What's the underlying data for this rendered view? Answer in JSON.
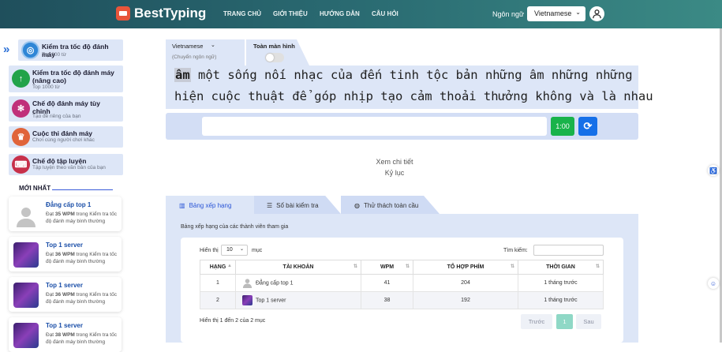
{
  "header": {
    "brand": "BestTyping",
    "nav": [
      "TRANG CHỦ",
      "GIỚI THIỆU",
      "HƯỚNG DẪN",
      "CÂU HỎI"
    ],
    "language_label": "Ngôn ngữ",
    "language_value": "Vietnamese"
  },
  "sidebar": {
    "items": [
      {
        "title": "Kiểm tra tốc độ đánh máy",
        "sub": "Top 200 từ",
        "color": "#2f86d6",
        "icon": "target-icon"
      },
      {
        "title": "Kiểm tra tốc độ đánh máy (nâng cao)",
        "sub": "Top 1000 từ",
        "color": "#22a34a",
        "icon": "arrow-up-icon"
      },
      {
        "title": "Chế độ đánh máy tùy chỉnh",
        "sub": "Tạo đề riêng của bạn",
        "color": "#c0307a",
        "icon": "cog-icon"
      },
      {
        "title": "Cuộc thi đánh máy",
        "sub": "Chơi cùng người chơi khác",
        "color": "#e0643a",
        "icon": "trophy-icon"
      },
      {
        "title": "Chế độ tập luyện",
        "sub": "Tập luyện theo văn bản của bạn",
        "color": "#c7304a",
        "icon": "keyboard-icon"
      }
    ],
    "newest_label": "MỚI NHẤT",
    "cards": [
      {
        "title": "Đẳng cấp top 1",
        "desc_pre": "Đạt ",
        "wpm": "35 WPM",
        "desc_post": " trong Kiểm tra tốc độ đánh máy bình thường"
      },
      {
        "title": "Top 1 server",
        "desc_pre": "Đạt ",
        "wpm": "36 WPM",
        "desc_post": " trong Kiểm tra tốc độ đánh máy bình thường"
      },
      {
        "title": "Top 1 server",
        "desc_pre": "Đạt ",
        "wpm": "36 WPM",
        "desc_post": " trong Kiểm tra tốc độ đánh máy bình thường"
      },
      {
        "title": "Top 1 server",
        "desc_pre": "Đạt ",
        "wpm": "38 WPM",
        "desc_post": " trong Kiểm tra tốc độ đánh máy bình thường"
      }
    ]
  },
  "typing": {
    "language": "Vietnamese",
    "language_hint": "(Chuyển ngôn ngữ)",
    "fullscreen_label": "Toàn màn hình",
    "fullscreen_on": false,
    "current_word": "âm",
    "line1_rest": " một sống nối nhạc của đến tinh tộc bản những âm những những",
    "line2": "hiện cuộc thuật để góp nhịp tạo cảm thoải thưởng không và là nhau",
    "input_value": "",
    "timer": "1:00"
  },
  "details_link": "Xem chi tiết",
  "record_label": "Kỷ lục",
  "tabs": [
    {
      "label": "Bảng xếp hạng",
      "icon": "bar-chart-icon"
    },
    {
      "label": "Sổ bài kiểm tra",
      "icon": "list-icon"
    },
    {
      "label": "Thử thách toàn cầu",
      "icon": "globe-icon"
    }
  ],
  "leaderboard": {
    "caption": "Bảng xếp hạng của các thành viên tham gia",
    "show_label": "Hiển thị",
    "show_value": "10",
    "show_suffix": "mục",
    "search_label": "Tìm kiếm:",
    "search_value": "",
    "columns": [
      "HẠNG",
      "TÀI KHOẢN",
      "WPM",
      "TỔ HỢP PHÍM",
      "THỜI GIAN"
    ],
    "rows": [
      {
        "rank": "1",
        "account": "Đẳng cấp top 1",
        "wpm": "41",
        "keys": "204",
        "time": "1 tháng trước",
        "avatar": "user"
      },
      {
        "rank": "2",
        "account": "Top 1 server",
        "wpm": "38",
        "keys": "192",
        "time": "1 tháng trước",
        "avatar": "game"
      }
    ],
    "info": "Hiển thị 1 đến 2 của 2 mục",
    "prev_label": "Trước",
    "current_page": "1",
    "next_label": "Sau"
  }
}
